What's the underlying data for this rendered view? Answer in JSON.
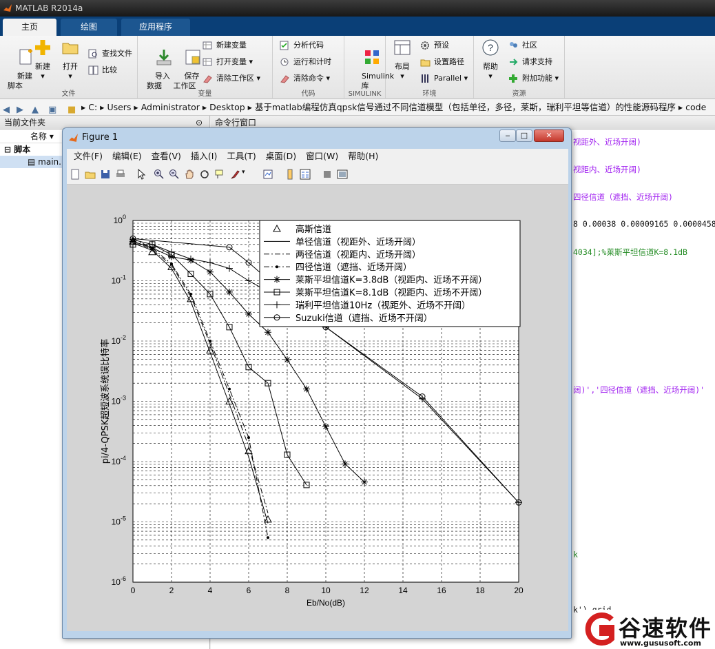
{
  "app": {
    "title": "MATLAB R2014a"
  },
  "tabs": [
    "主页",
    "绘图",
    "应用程序"
  ],
  "ribbon": {
    "file": {
      "label": "文件",
      "new_script": "新建\n脚本",
      "new": "新建",
      "open": "打开",
      "find_files": "查找文件",
      "compare": "比较"
    },
    "variable": {
      "label": "变量",
      "import": "导入\n数据",
      "save": "保存\n工作区",
      "new_var": "新建变量",
      "open_var": "打开变量",
      "clear_ws": "清除工作区"
    },
    "code": {
      "label": "代码",
      "analyze": "分析代码",
      "run_time": "运行和计时",
      "clear_cmd": "清除命令"
    },
    "simulink": {
      "label": "SIMULINK",
      "lib": "Simulink\n库"
    },
    "env": {
      "label": "环境",
      "layout": "布局",
      "prefs": "预设",
      "set_path": "设置路径",
      "parallel": "Parallel"
    },
    "resources": {
      "label": "资源",
      "help": "帮助",
      "community": "社区",
      "support": "请求支持",
      "addons": "附加功能"
    }
  },
  "address": {
    "crumbs": [
      "C:",
      "Users",
      "Administrator",
      "Desktop",
      "基于matlab编程仿真qpsk信号通过不同信道模型（包括单径，多径，莱斯，瑞利平坦等信道）的性能源码程序",
      "code"
    ]
  },
  "left_panel": {
    "title": "当前文件夹",
    "col_name": "名称",
    "group": "脚本",
    "file": "main.m"
  },
  "cmd_panel": {
    "title": "命令行窗口",
    "lines": [
      {
        "text": "视距外、近场开阔)",
        "color": "#a020f0"
      },
      {
        "text": "视距内、近场开阔)",
        "color": "#a020f0"
      },
      {
        "text": "四径信道（遮挡、近场开阔)",
        "color": "#a020f0"
      },
      {
        "text": "8 0.00038 0.00009165 0.0000458",
        "color": "#111"
      },
      {
        "text": "4034];%莱斯平坦信道K=8.1dB",
        "color": "#228b22"
      },
      {
        "text": "阔)','四径信道（遮挡、近场开阔)'",
        "color": "#a020f0"
      },
      {
        "text": "k",
        "color": "#228b22"
      },
      {
        "text": "k'),grid",
        "color": "#111"
      }
    ]
  },
  "figure": {
    "title": "Figure 1",
    "menu": [
      "文件(F)",
      "编辑(E)",
      "查看(V)",
      "插入(I)",
      "工具(T)",
      "桌面(D)",
      "窗口(W)",
      "帮助(H)"
    ]
  },
  "chart_data": {
    "type": "line",
    "xlabel": "Eb/No(dB)",
    "ylabel": "pi/4-QPSK超短波系统误比特率",
    "yscale": "log",
    "xlim": [
      0,
      20
    ],
    "ylim": [
      1e-06,
      1
    ],
    "xticks": [
      0,
      2,
      4,
      6,
      8,
      10,
      12,
      14,
      16,
      18,
      20
    ],
    "yticks": [
      "10^0",
      "10^-1",
      "10^-2",
      "10^-3",
      "10^-4",
      "10^-5",
      "10^-6"
    ],
    "grid": true,
    "legend_position": "top-right",
    "series": [
      {
        "name": "高斯信道",
        "marker": "triangle",
        "dash": "none",
        "x": [
          0,
          1,
          2,
          3,
          4,
          5,
          6,
          7
        ],
        "y": [
          0.45,
          0.3,
          0.17,
          0.05,
          0.007,
          0.001,
          0.00015,
          1.1e-05
        ]
      },
      {
        "name": "单径信道（视距外、近场开阔）",
        "marker": "none",
        "dash": "solid",
        "x": [
          0,
          1,
          2,
          3,
          4,
          5,
          6,
          7
        ],
        "y": [
          0.42,
          0.32,
          0.16,
          0.045,
          0.0065,
          0.0009,
          0.00012,
          9.5e-06
        ]
      },
      {
        "name": "两径信道（视距内、近场开阔）",
        "marker": "none",
        "dash": "dashdot",
        "x": [
          0,
          1,
          2,
          3,
          4,
          5,
          6,
          7
        ],
        "y": [
          0.45,
          0.33,
          0.18,
          0.055,
          0.009,
          0.0013,
          0.00018,
          1.4e-05
        ]
      },
      {
        "name": "四径信道（遮挡、近场开阔）",
        "marker": "dot",
        "dash": "dashdot",
        "x": [
          0,
          1,
          2,
          3,
          4,
          5,
          6,
          7
        ],
        "y": [
          0.5,
          0.35,
          0.19,
          0.06,
          0.01,
          0.0016,
          0.00025,
          5.5e-06
        ]
      },
      {
        "name": "莱斯平坦信道K=3.8dB（视距内、近场不开阔）",
        "marker": "star",
        "dash": "solid",
        "x": [
          0,
          1,
          2,
          3,
          4,
          5,
          6,
          7,
          8,
          9,
          10,
          11,
          12
        ],
        "y": [
          0.45,
          0.35,
          0.25,
          0.22,
          0.14,
          0.065,
          0.028,
          0.014,
          0.0049,
          0.0016,
          0.00038,
          9.165e-05,
          4.58e-05
        ]
      },
      {
        "name": "莱斯平坦信道K=8.1dB（视距内、近场不开阔）",
        "marker": "square",
        "dash": "solid",
        "x": [
          0,
          1,
          2,
          3,
          4,
          5,
          6,
          7,
          8,
          9
        ],
        "y": [
          0.4,
          0.4,
          0.27,
          0.13,
          0.06,
          0.017,
          0.0037,
          0.002,
          0.00013,
          4.1e-05
        ]
      },
      {
        "name": "瑞利平坦信道10Hz（视距外、近场不开阔）",
        "marker": "plus",
        "dash": "solid",
        "x": [
          0,
          1,
          2,
          3,
          4,
          5,
          6,
          8,
          10,
          15,
          20
        ],
        "y": [
          0.48,
          0.4,
          0.3,
          0.23,
          0.2,
          0.16,
          0.1,
          0.044,
          0.017,
          0.0011,
          2.1e-05
        ]
      },
      {
        "name": "Suzuki信道（遮挡、近场不开阔）",
        "marker": "circle",
        "dash": "solid",
        "x": [
          0,
          5,
          6,
          8,
          10,
          15,
          20
        ],
        "y": [
          0.5,
          0.36,
          0.2,
          0.055,
          0.017,
          0.0012,
          2.1e-05
        ]
      }
    ]
  },
  "watermark": {
    "brand": "谷速软件",
    "url": "www.gususoft.com"
  }
}
